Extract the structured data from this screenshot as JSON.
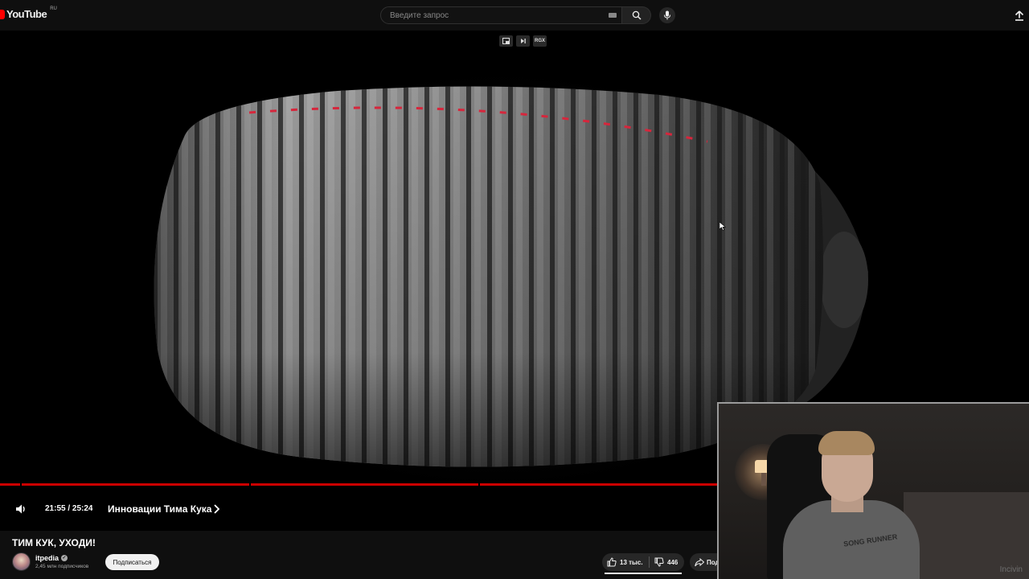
{
  "header": {
    "logo_text": "YouTube",
    "region": "RU",
    "search_placeholder": "Введите запрос",
    "icons": [
      "keyboard-icon",
      "search-icon",
      "mic-icon",
      "upload-icon"
    ]
  },
  "player": {
    "miniplayer_labels": {
      "speed": "RGX"
    },
    "progress_fraction": 0.8697,
    "time_display": "21:55 / 25:24",
    "chapter_title": "Инновации Тима Кука",
    "accent_color": "#cc0000"
  },
  "video_info": {
    "title": "ТИМ КУК, УХОДИ!",
    "channel": {
      "name": "itpedia",
      "verified_mark": "✓",
      "subscribers": "2,45 млн подписчиков"
    },
    "subscribe_label": "Подписаться",
    "likes": "13 тыс.",
    "dislikes": "446",
    "share_label": "Под"
  },
  "webcam": {
    "shirt_text": "SONG RUNNER",
    "watermark": "Incivin"
  }
}
